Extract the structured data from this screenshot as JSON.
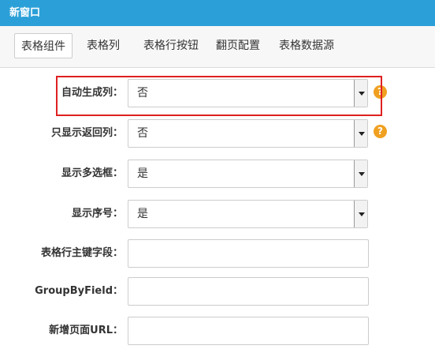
{
  "window": {
    "title": "新窗口"
  },
  "tabs": [
    {
      "label": "表格组件",
      "active": true
    },
    {
      "label": "表格列",
      "active": false
    },
    {
      "label": "表格行按钮",
      "active": false
    },
    {
      "label": "翻页配置",
      "active": false
    },
    {
      "label": "表格数据源",
      "active": false
    }
  ],
  "form": {
    "auto_generate_columns": {
      "label": "自动生成列：",
      "value": "否",
      "help": "?"
    },
    "show_returned_columns_only": {
      "label": "只显示返回列：",
      "value": "否",
      "help": "?"
    },
    "show_multi_checkbox": {
      "label": "显示多选框：",
      "value": "是"
    },
    "show_row_number": {
      "label": "显示序号：",
      "value": "是"
    },
    "primary_key_field": {
      "label": "表格行主键字段：",
      "value": ""
    },
    "group_by_field": {
      "label": "GroupByField：",
      "value": ""
    },
    "add_page_url": {
      "label": "新增页面URL：",
      "value": ""
    }
  },
  "colors": {
    "titlebar": "#2ba0d8",
    "help_icon": "#f0a020",
    "highlight_border": "#e02020"
  }
}
